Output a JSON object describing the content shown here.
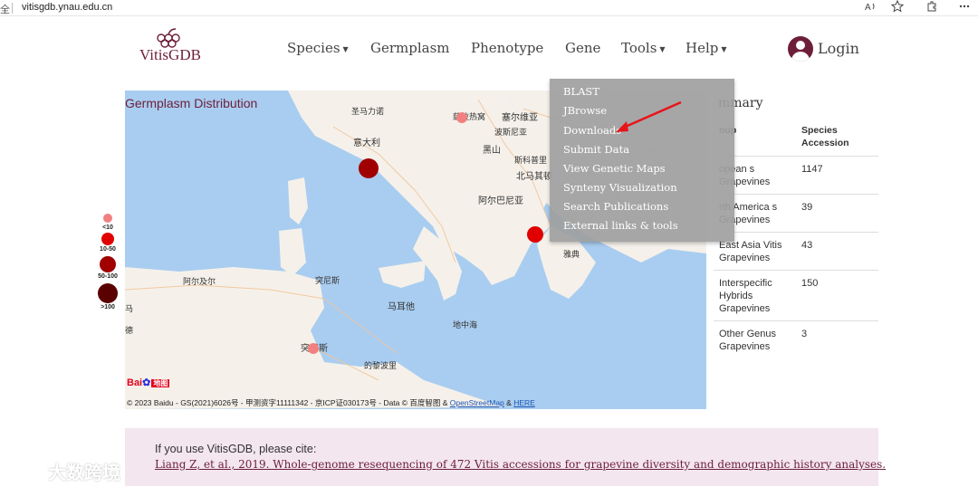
{
  "browser": {
    "left_icon": "全",
    "url": "vitisgdb.ynau.edu.cn",
    "icons": [
      "read-aloud-icon",
      "favorite-star-icon",
      "extensions-icon",
      "more-icon"
    ]
  },
  "header": {
    "logo_text": "VitisGDB",
    "nav": [
      "Species",
      "Germplasm",
      "Phenotype",
      "Gene",
      "Tools",
      "Help"
    ],
    "login_label": "Login"
  },
  "map": {
    "title": "Germplasm Distribution",
    "labels": [
      "圣马力诺",
      "意大利",
      "萨拉热窝",
      "塞尔维亚",
      "波斯尼亚",
      "黑山",
      "斯科普里",
      "北马其顿",
      "阿尔巴尼亚",
      "雅典",
      "阿尔及尔",
      "突尼斯",
      "马耳他",
      "突尼斯",
      "的黎波里",
      "地中海",
      "马",
      "德"
    ],
    "copyright": "© 2023 Baidu - GS(2021)6026号 - 甲测资字11111342 - 京ICP证030173号 - Data © 百度智图 & ",
    "osm_link": "OpenStreetMap",
    "amp": " & ",
    "here_link": "HERE",
    "baidu_logo": "Bai",
    "baidu_map": "地图"
  },
  "legend": [
    "<10",
    "10-50",
    "50-100",
    ">100"
  ],
  "summary": {
    "title": "mmary",
    "header": [
      "oup",
      "Species Accession"
    ],
    "rows": [
      [
        "opean s Grapevines",
        "1147"
      ],
      [
        "rth America s Grapevines",
        "39"
      ],
      [
        "East Asia Vitis Grapevines",
        "43"
      ],
      [
        "Interspecific Hybrids Grapevines",
        "150"
      ],
      [
        "Other Genus Grapevines",
        "3"
      ]
    ]
  },
  "tools_menu": [
    "BLAST",
    "JBrowse",
    "Downloads",
    "Submit Data",
    "View Genetic Maps",
    "Synteny Visualization",
    "Search Publications",
    "External links & tools"
  ],
  "citation": {
    "intro": "If you use VitisGDB, please cite:",
    "reference": "Liang Z, et al., 2019. Whole-genome resequencing of 472 Vitis accessions for grapevine diversity and demographic history analyses."
  },
  "watermark": "大数跨境",
  "colors": {
    "brand": "#6d1f3a",
    "dot_lt10": "#f28080",
    "dot_10_50": "#e00000",
    "dot_50_100": "#a00000",
    "dot_gt100": "#5a0000",
    "arrow": "#e8141b"
  }
}
